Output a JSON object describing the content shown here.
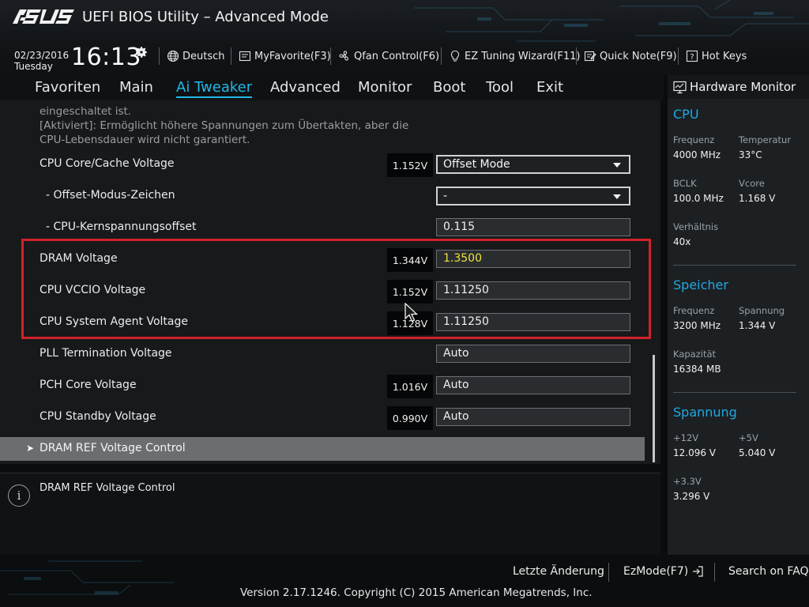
{
  "app": {
    "brand": "ASUS",
    "title": "UEFI BIOS Utility – Advanced Mode"
  },
  "datetime": {
    "date": "02/23/2016",
    "day": "Tuesday",
    "time": "16:13"
  },
  "toolbar": {
    "language": "Deutsch",
    "myfavorite": "MyFavorite(F3)",
    "qfan": "Qfan Control(F6)",
    "ez_tuning": "EZ Tuning Wizard(F11)",
    "quick_note": "Quick Note(F9)",
    "hot_keys": "Hot Keys"
  },
  "nav": {
    "tabs": [
      "Favoriten",
      "Main",
      "Ai Tweaker",
      "Advanced",
      "Monitor",
      "Boot",
      "Tool",
      "Exit"
    ],
    "active": "Ai Tweaker"
  },
  "description": {
    "line1": "eingeschaltet ist.",
    "line2": "[Aktiviert]: Ermöglicht höhere Spannungen zum Übertakten, aber die",
    "line3": "CPU-Lebensdauer wird nicht garantiert."
  },
  "settings": [
    {
      "label": "CPU Core/Cache Voltage",
      "reading": "1.152V",
      "value": "Offset Mode",
      "control": "dropdown"
    },
    {
      "label": "- Offset-Modus-Zeichen",
      "reading": "",
      "value": "-",
      "control": "dropdown"
    },
    {
      "label": "- CPU-Kernspannungsoffset",
      "reading": "",
      "value": "0.115",
      "control": "field"
    },
    {
      "label": "DRAM Voltage",
      "reading": "1.344V",
      "value": "1.3500",
      "control": "field"
    },
    {
      "label": "CPU VCCIO Voltage",
      "reading": "1.152V",
      "value": "1.11250",
      "control": "field"
    },
    {
      "label": "CPU System Agent Voltage",
      "reading": "1.128V",
      "value": "1.11250",
      "control": "field"
    },
    {
      "label": "PLL Termination Voltage",
      "reading": "",
      "value": "Auto",
      "control": "field"
    },
    {
      "label": "PCH Core Voltage",
      "reading": "1.016V",
      "value": "Auto",
      "control": "field"
    },
    {
      "label": "CPU Standby Voltage",
      "reading": "0.990V",
      "value": "Auto",
      "control": "field"
    }
  ],
  "submenu": {
    "label": "DRAM REF Voltage Control"
  },
  "info": {
    "text": "DRAM REF Voltage Control"
  },
  "hardware_monitor": {
    "title": "Hardware Monitor",
    "cpu": {
      "heading": "CPU",
      "freq_label": "Frequenz",
      "freq": "4000 MHz",
      "temp_label": "Temperatur",
      "temp": "33°C",
      "bclk_label": "BCLK",
      "bclk": "100.0 MHz",
      "vcore_label": "Vcore",
      "vcore": "1.168 V",
      "ratio_label": "Verhältnis",
      "ratio": "40x"
    },
    "memory": {
      "heading": "Speicher",
      "freq_label": "Frequenz",
      "freq": "3200 MHz",
      "volt_label": "Spannung",
      "volt": "1.344 V",
      "cap_label": "Kapazität",
      "cap": "16384 MB"
    },
    "voltage": {
      "heading": "Spannung",
      "v12_label": "+12V",
      "v12": "12.096 V",
      "v5_label": "+5V",
      "v5": "5.040 V",
      "v33_label": "+3.3V",
      "v33": "3.296 V"
    }
  },
  "footer": {
    "last_change": "Letzte Änderung",
    "ezmode": "EzMode(F7)",
    "search_faq": "Search on FAQ",
    "version": "Version 2.17.1246. Copyright (C) 2015 American Megatrends, Inc."
  },
  "colors": {
    "accent": "#22b8e8",
    "highlight_border": "#d0222a",
    "modified_value": "#f0e33a"
  }
}
